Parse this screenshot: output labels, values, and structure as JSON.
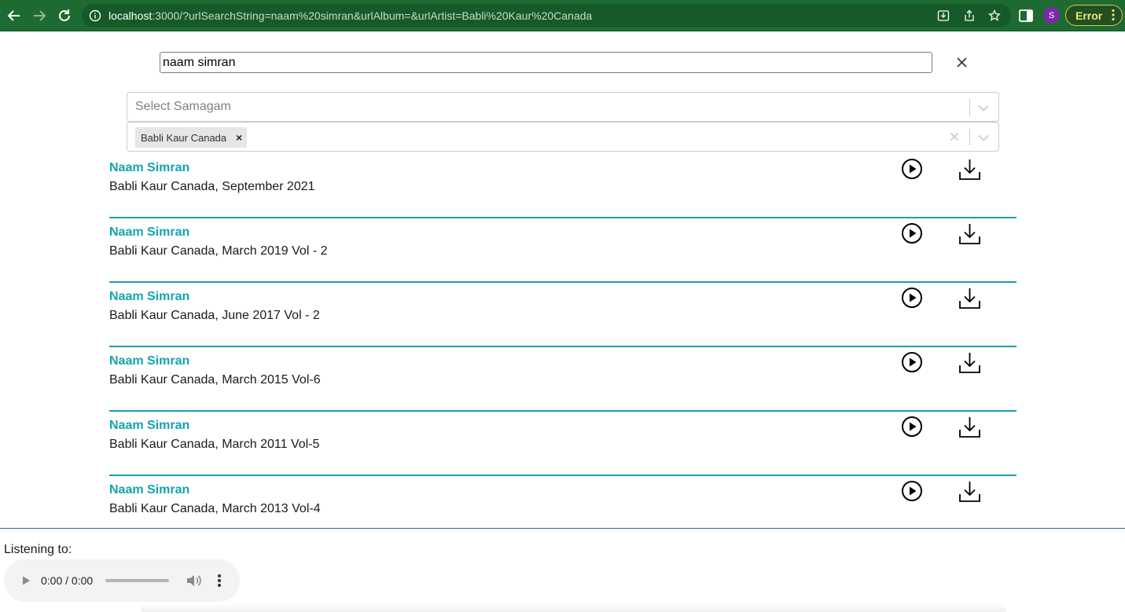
{
  "browser": {
    "url_host": "localhost",
    "url_rest": ":3000/?urlSearchString=naam%20simran&urlAlbum=&urlArtist=Babli%20Kaur%20Canada",
    "profile_initial": "S",
    "error_label": "Error",
    "icons": [
      "back-icon",
      "forward-icon",
      "reload-icon",
      "info-icon",
      "install-icon",
      "share-icon",
      "bookmark-star-icon",
      "sidebar-icon",
      "kebab-menu-icon"
    ]
  },
  "search": {
    "value": "naam simran"
  },
  "filters": {
    "samagam_placeholder": "Select Samagam",
    "artist_selected": "Babli Kaur Canada",
    "chip_remove": "×"
  },
  "results": [
    {
      "title": "Naam Simran",
      "subtitle": "Babli Kaur Canada, September 2021"
    },
    {
      "title": "Naam Simran",
      "subtitle": "Babli Kaur Canada, March 2019 Vol - 2"
    },
    {
      "title": "Naam Simran",
      "subtitle": "Babli Kaur Canada, June 2017 Vol - 2"
    },
    {
      "title": "Naam Simran",
      "subtitle": "Babli Kaur Canada, March 2015 Vol-6"
    },
    {
      "title": "Naam Simran",
      "subtitle": "Babli Kaur Canada, March 2011 Vol-5"
    },
    {
      "title": "Naam Simran",
      "subtitle": "Babli Kaur Canada, March 2013 Vol-4"
    }
  ],
  "player": {
    "label": "Listening to:",
    "time": "0:00 / 0:00",
    "progress": 0
  },
  "colors": {
    "chrome_bg": "#1d6b32",
    "accent": "#13a5ac",
    "divider": "#1a9fa8",
    "error_text": "#f2e66a"
  }
}
